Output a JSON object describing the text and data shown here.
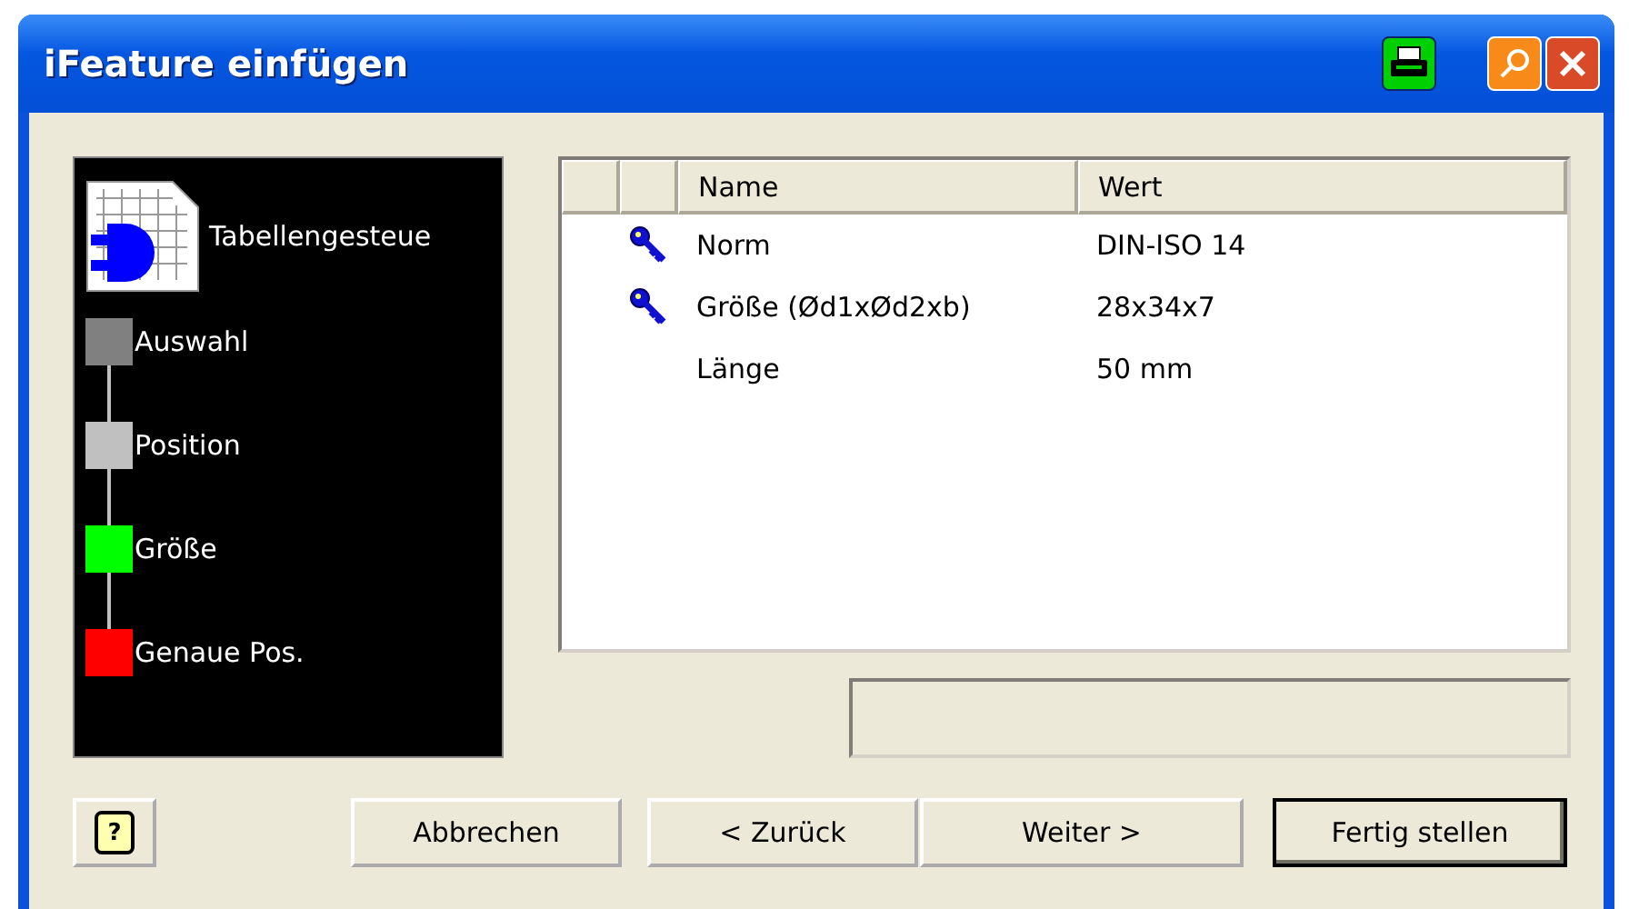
{
  "window": {
    "title": "iFeature einfügen"
  },
  "sidebar": {
    "title": "Tabellengesteue",
    "steps": [
      {
        "label": "Auswahl",
        "color": "#808080"
      },
      {
        "label": "Position",
        "color": "#c0c0c0"
      },
      {
        "label": "Größe",
        "color": "#00ff00"
      },
      {
        "label": "Genaue Pos.",
        "color": "#ff0000"
      }
    ]
  },
  "table": {
    "columns": [
      "Name",
      "Wert"
    ],
    "rows": [
      {
        "kind": "key",
        "name": "Norm",
        "value": "DIN-ISO 14"
      },
      {
        "kind": "key",
        "name": "Größe (Ød1xØd2xb)",
        "value": "28x34x7"
      },
      {
        "kind": "plain",
        "name": "Länge",
        "value": "50 mm"
      }
    ]
  },
  "help_button": {
    "label": "?"
  },
  "buttons": [
    {
      "label": "Abbrechen",
      "default": false
    },
    {
      "label": "< Zurück",
      "default": false
    },
    {
      "label": "Weiter >",
      "default": false
    },
    {
      "label": "Fertig stellen",
      "default": true
    }
  ]
}
